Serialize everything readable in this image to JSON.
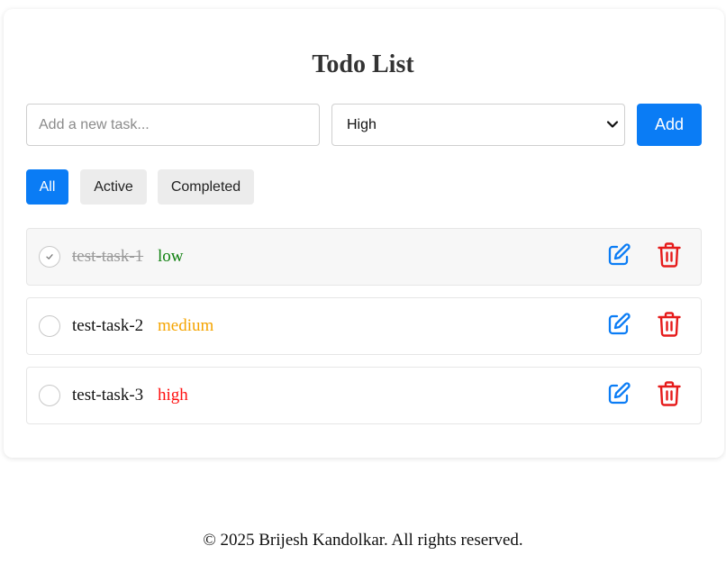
{
  "app": {
    "title": "Todo List"
  },
  "form": {
    "input_placeholder": "Add a new task...",
    "input_value": "",
    "priority_selected": "High",
    "add_label": "Add"
  },
  "filters": [
    {
      "label": "All",
      "active": true
    },
    {
      "label": "Active",
      "active": false
    },
    {
      "label": "Completed",
      "active": false
    }
  ],
  "tasks": [
    {
      "text": "test-task-1",
      "priority": "low",
      "completed": true,
      "priority_color": "#108010"
    },
    {
      "text": "test-task-2",
      "priority": "medium",
      "completed": false,
      "priority_color": "#f5a400"
    },
    {
      "text": "test-task-3",
      "priority": "high",
      "completed": false,
      "priority_color": "#ff1010"
    }
  ],
  "footer": {
    "text": "© 2025 Brijesh Kandolkar. All rights reserved."
  },
  "colors": {
    "accent": "#0a7cf5",
    "delete": "#e61b1b"
  },
  "icons": {
    "edit": "edit-icon",
    "delete": "trash-icon",
    "check": "check-icon",
    "select": "chevron-down-icon"
  }
}
